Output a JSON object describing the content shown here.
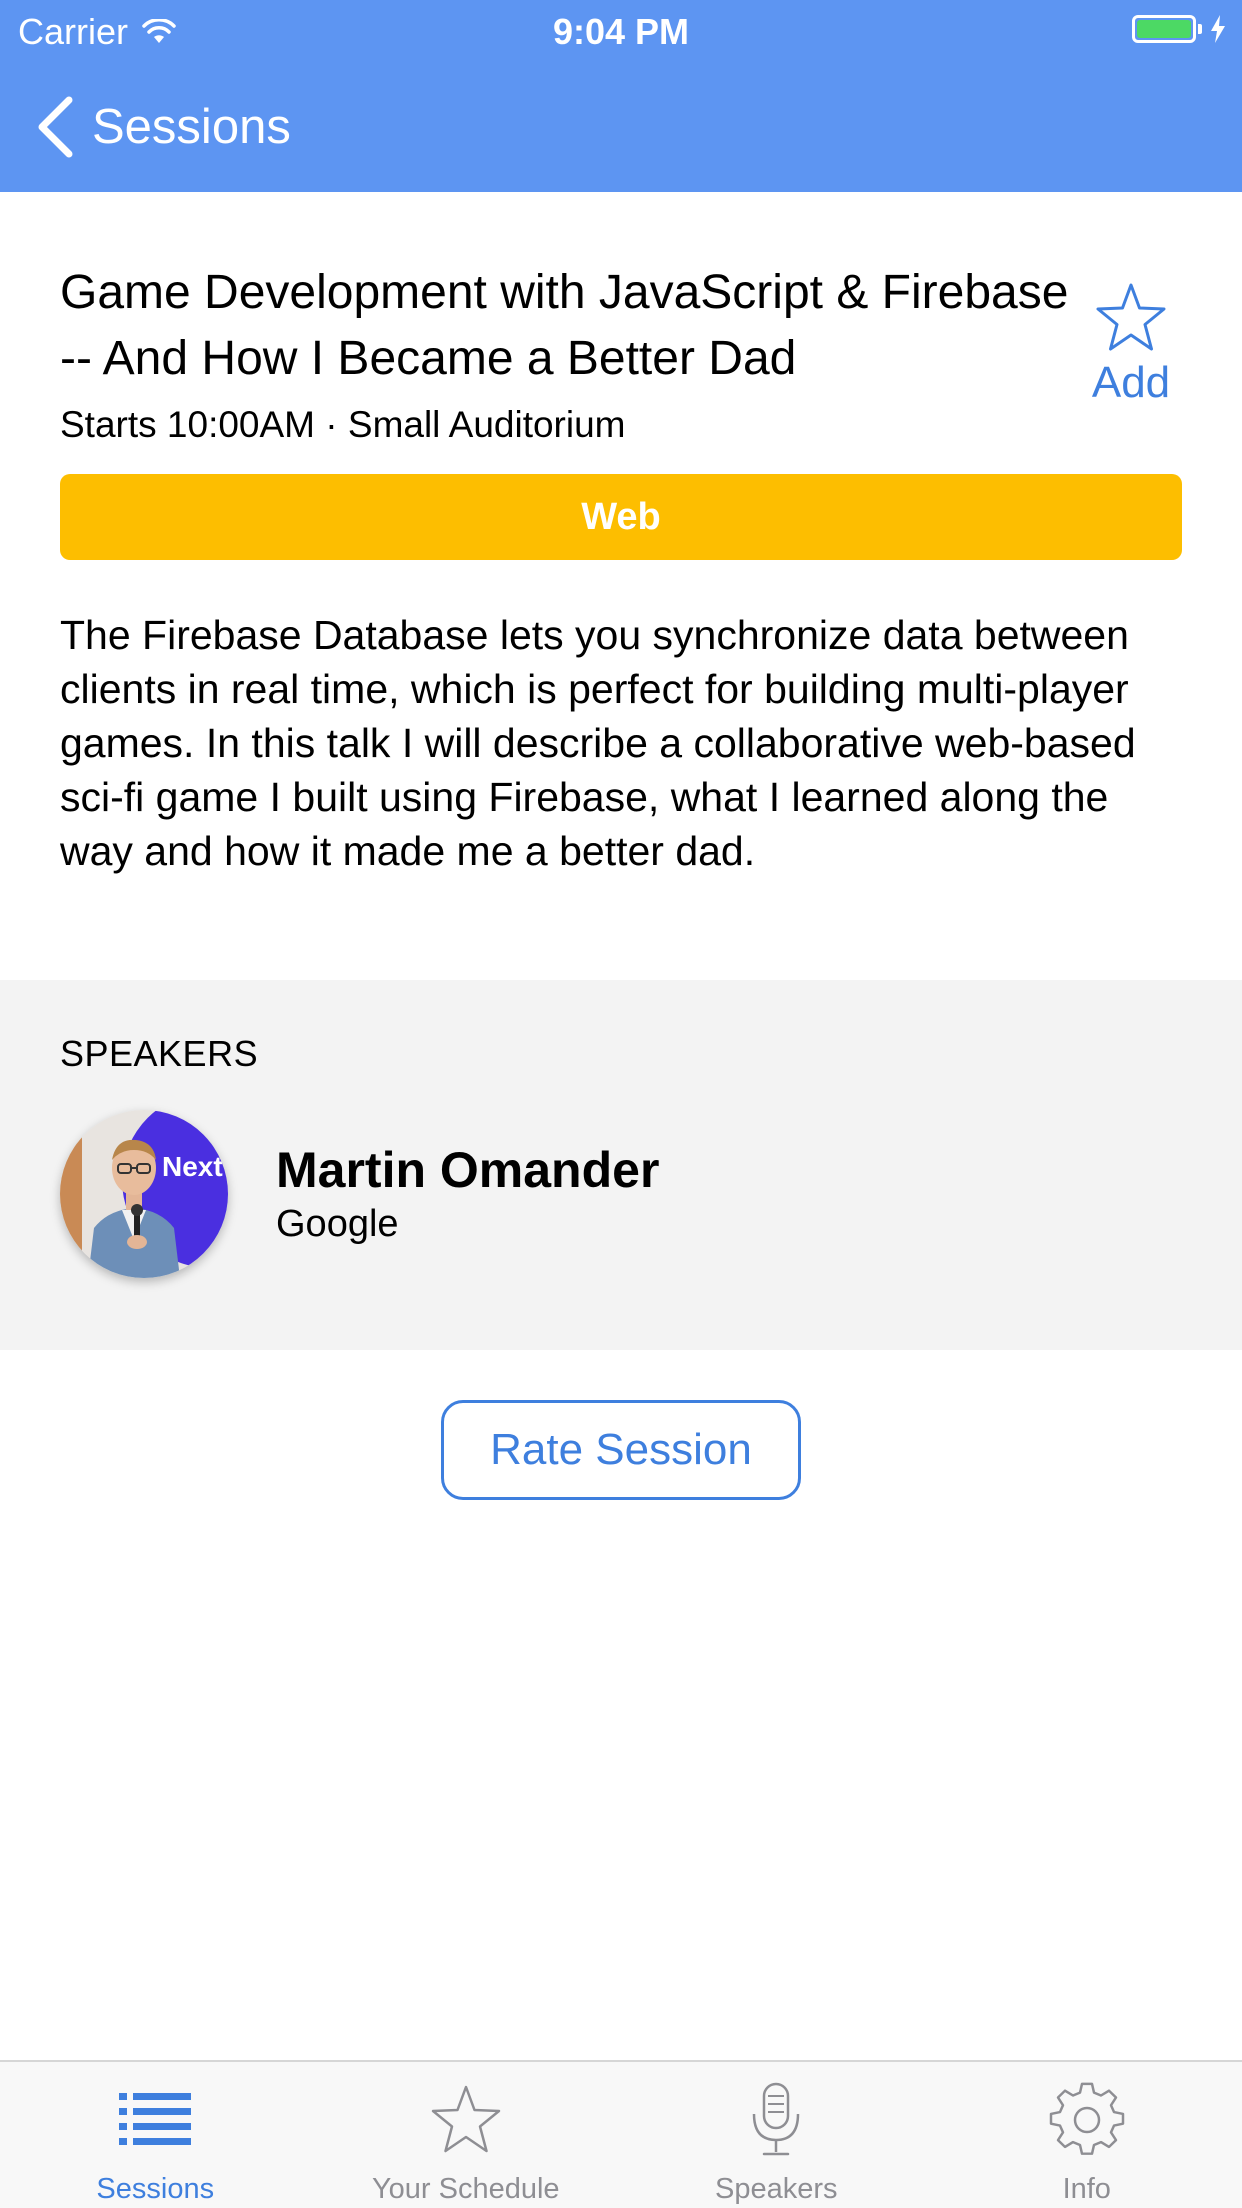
{
  "status_bar": {
    "carrier": "Carrier",
    "time": "9:04 PM",
    "battery_color": "#4cd964"
  },
  "nav": {
    "back_label": "Sessions",
    "background": "#5d95f2",
    "back_icon": "chevron-left-icon"
  },
  "session": {
    "title": "Game Development with JavaScript & Firebase -- And How I Became a Better Dad",
    "meta": "Starts 10:00AM · Small Auditorium",
    "add_label": "Add",
    "add_icon": "star-outline-icon",
    "track": "Web",
    "track_color": "#fdbe00",
    "description": "The Firebase Database lets you synchronize data between clients in real time, which is perfect for building multi-player games. In this talk I will describe a collaborative web-based sci-fi game I built using Firebase, what I learned along the way and how it made me a better dad."
  },
  "speakers": {
    "heading": "SPEAKERS",
    "items": [
      {
        "name": "Martin Omander",
        "company": "Google",
        "avatar_badge": "Next"
      }
    ]
  },
  "rate_button": {
    "label": "Rate Session"
  },
  "tab_bar": {
    "accent": "#3e7fde",
    "tabs": [
      {
        "label": "Sessions",
        "icon": "list-icon",
        "active": true
      },
      {
        "label": "Your Schedule",
        "icon": "star-outline-icon",
        "active": false
      },
      {
        "label": "Speakers",
        "icon": "microphone-icon",
        "active": false
      },
      {
        "label": "Info",
        "icon": "gear-icon",
        "active": false
      }
    ]
  }
}
